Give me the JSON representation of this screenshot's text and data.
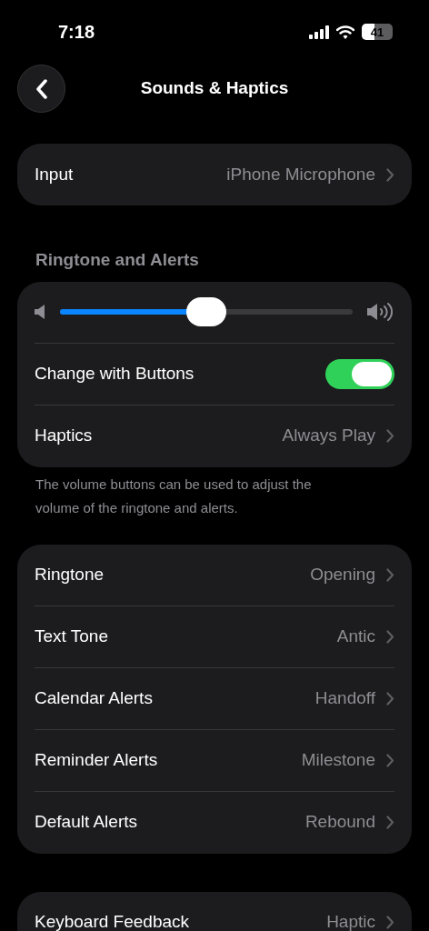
{
  "status_bar": {
    "time": "7:18",
    "battery": "41"
  },
  "nav": {
    "title": "Sounds & Haptics"
  },
  "groups": [
    {
      "rows": [
        {
          "kind": "link",
          "label": "Input",
          "value": "iPhone Microphone"
        }
      ]
    },
    {
      "header": "Ringtone and Alerts",
      "rows": [
        {
          "kind": "slider",
          "level": 0.5
        },
        {
          "kind": "toggle",
          "label": "Change with Buttons",
          "on": true
        },
        {
          "kind": "link",
          "label": "Haptics",
          "value": "Always Play"
        }
      ],
      "footer": "The volume buttons can be used to adjust the volume of the ringtone and alerts."
    },
    {
      "rows": [
        {
          "kind": "link",
          "label": "Ringtone",
          "value": "Opening"
        },
        {
          "kind": "link",
          "label": "Text Tone",
          "value": "Antic"
        },
        {
          "kind": "link",
          "label": "Calendar Alerts",
          "value": "Handoff"
        },
        {
          "kind": "link",
          "label": "Reminder Alerts",
          "value": "Milestone"
        },
        {
          "kind": "link",
          "label": "Default Alerts",
          "value": "Rebound"
        }
      ]
    },
    {
      "rows": [
        {
          "kind": "link",
          "label": "Keyboard Feedback",
          "value": "Haptic"
        }
      ]
    }
  ]
}
